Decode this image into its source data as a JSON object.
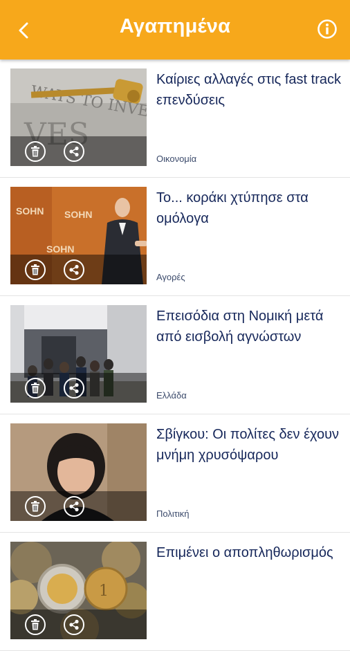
{
  "header": {
    "title": "Αγαπημένα",
    "bg_color": "#f7a81b"
  },
  "articles": [
    {
      "headline": "Καίριες αλλαγές στις fast track επενδύσεις",
      "category": "Οικονομία"
    },
    {
      "headline": "Το... κοράκι χτύπησε στα ομόλογα",
      "category": "Αγορές"
    },
    {
      "headline": "Επεισόδια στη Νομική μετά από εισβολή αγνώστων",
      "category": "Ελλάδα"
    },
    {
      "headline": "Σβίγκου: Οι πολίτες δεν έχουν μνήμη χρυσόψαρου",
      "category": "Πολιτική"
    },
    {
      "headline": "Επιμένει ο αποπληθωρισμός",
      "category": ""
    }
  ],
  "thumb_texts": {
    "invest": "WAYS TO INVEST",
    "sohn": "SOHN"
  },
  "icons": {
    "back": "back-arrow-icon",
    "info": "info-icon",
    "delete": "trash-icon",
    "share": "share-icon"
  }
}
